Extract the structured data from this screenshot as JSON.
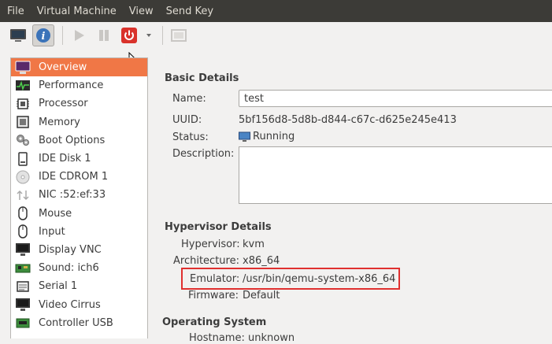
{
  "menu": [
    "File",
    "Virtual Machine",
    "View",
    "Send Key"
  ],
  "toolbar": {
    "icons": [
      "monitor-icon",
      "info-icon",
      "play-icon",
      "pause-icon",
      "power-icon",
      "dropdown-arrow-icon",
      "fullscreen-icon"
    ]
  },
  "sidebar": {
    "items": [
      {
        "label": "Overview",
        "icon": "overview-icon"
      },
      {
        "label": "Performance",
        "icon": "performance-icon"
      },
      {
        "label": "Processor",
        "icon": "cpu-icon"
      },
      {
        "label": "Memory",
        "icon": "memory-icon"
      },
      {
        "label": "Boot Options",
        "icon": "boot-gears-icon"
      },
      {
        "label": "IDE Disk 1",
        "icon": "disk-icon"
      },
      {
        "label": "IDE CDROM 1",
        "icon": "cdrom-icon"
      },
      {
        "label": "NIC :52:ef:33",
        "icon": "nic-icon"
      },
      {
        "label": "Mouse",
        "icon": "mouse-icon"
      },
      {
        "label": "Input",
        "icon": "input-icon"
      },
      {
        "label": "Display VNC",
        "icon": "display-icon"
      },
      {
        "label": "Sound: ich6",
        "icon": "sound-card-icon"
      },
      {
        "label": "Serial 1",
        "icon": "serial-icon"
      },
      {
        "label": "Video Cirrus",
        "icon": "video-icon"
      },
      {
        "label": "Controller USB",
        "icon": "controller-icon"
      }
    ]
  },
  "basic": {
    "title": "Basic Details",
    "name_label": "Name:",
    "name_value": "test",
    "uuid_label": "UUID:",
    "uuid_value": "5bf156d8-5d8b-d844-c67c-d625e245e413",
    "status_label": "Status:",
    "status_value": "Running",
    "description_label": "Description:"
  },
  "hypervisor": {
    "title": "Hypervisor Details",
    "hypervisor_label": "Hypervisor:",
    "hypervisor_value": "kvm",
    "arch_label": "Architecture:",
    "arch_value": "x86_64",
    "emulator_label": "Emulator:",
    "emulator_value": "/usr/bin/qemu-system-x86_64",
    "firmware_label": "Firmware:",
    "firmware_value": "Default"
  },
  "os": {
    "title": "Operating System",
    "hostname_label": "Hostname:",
    "hostname_value": "unknown"
  },
  "colors": {
    "selected_bg": "#f07746",
    "menubar_bg": "#3c3b37",
    "highlight": "#e0302f"
  }
}
